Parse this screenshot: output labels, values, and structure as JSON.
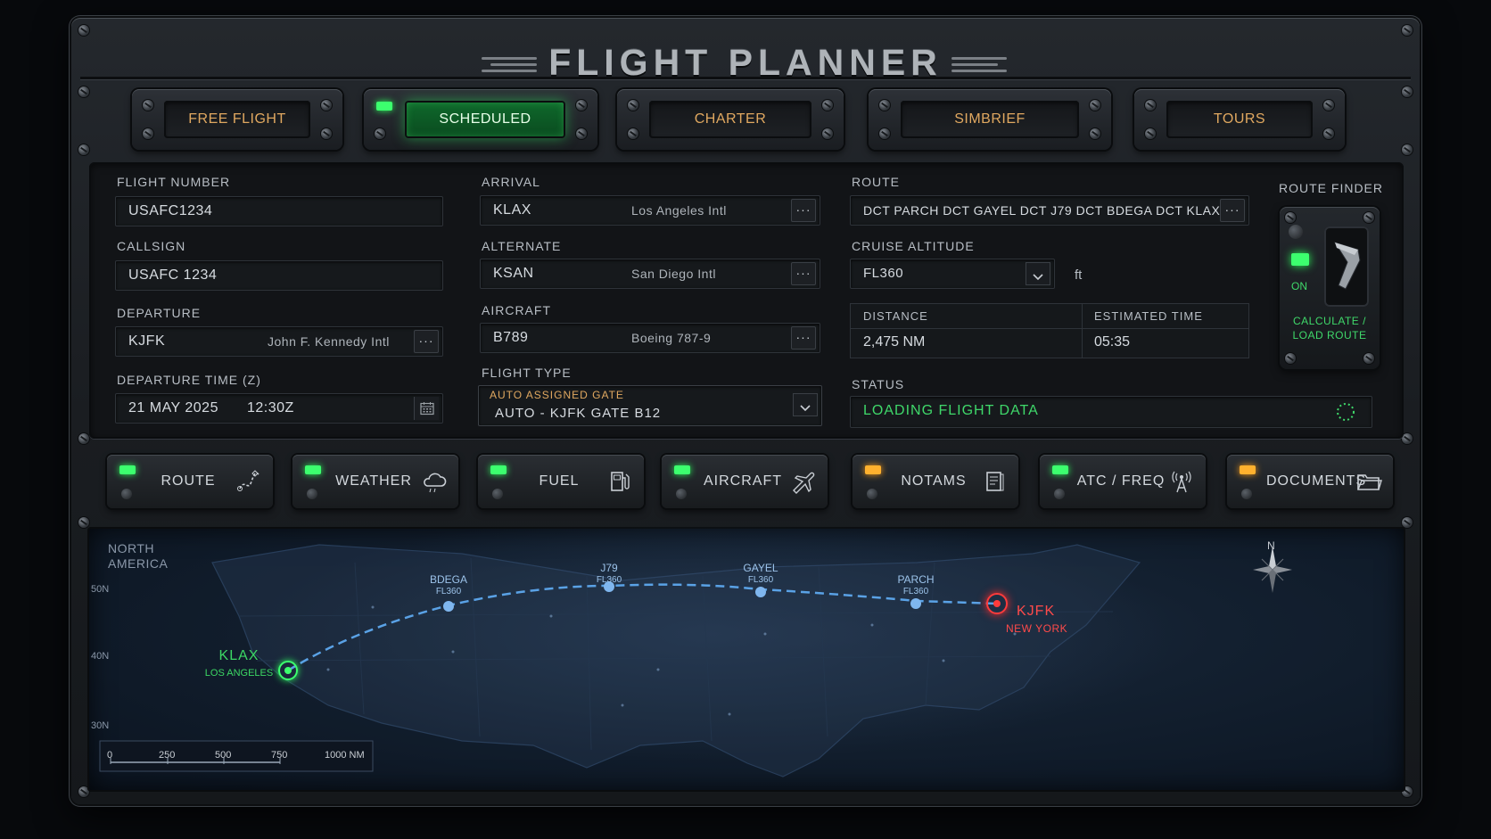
{
  "app": {
    "title": "FLIGHT PLANNER"
  },
  "modes": [
    {
      "label": "FREE FLIGHT",
      "active": false
    },
    {
      "label": "SCHEDULED",
      "active": true
    },
    {
      "label": "CHARTER",
      "active": false
    },
    {
      "label": "SIMBRIEF",
      "active": false
    },
    {
      "label": "TOURS",
      "active": false
    }
  ],
  "form": {
    "flight_number": {
      "label": "FLIGHT NUMBER",
      "value": "USAFC1234"
    },
    "callsign": {
      "label": "CALLSIGN",
      "value": "USAFC 1234"
    },
    "departure": {
      "label": "DEPARTURE",
      "code": "KJFK",
      "name": "John F. Kennedy Intl",
      "button": "···"
    },
    "departure_time": {
      "label": "DEPARTURE TIME (Z)",
      "date": "21 MAY 2025",
      "time": "12:30Z"
    },
    "arrival": {
      "label": "ARRIVAL",
      "code": "KLAX",
      "name": "Los Angeles Intl",
      "button": "···"
    },
    "alternate": {
      "label": "ALTERNATE",
      "code": "KSAN",
      "name": "San Diego Intl",
      "button": "···"
    },
    "aircraft": {
      "label": "AIRCRAFT",
      "code": "B789",
      "name": "Boeing 787-9",
      "button": "···"
    },
    "flight_type": {
      "label": "FLIGHT TYPE",
      "sublabel": "AUTO ASSIGNED GATE",
      "value": "AUTO - KJFK GATE B12"
    },
    "route": {
      "label": "ROUTE",
      "value": "DCT PARCH DCT GAYEL DCT J79 DCT BDEGA DCT KLAX",
      "button": "···"
    },
    "cruise_altitude": {
      "label": "CRUISE ALTITUDE",
      "value": "FL360",
      "unit": "ft"
    },
    "distance": {
      "label": "DISTANCE",
      "value": "2,475 NM"
    },
    "estimated_time": {
      "label": "ESTIMATED TIME",
      "value": "05:35"
    },
    "status": {
      "label": "STATUS",
      "value": "LOADING FLIGHT DATA"
    }
  },
  "route_finder": {
    "label": "ROUTE FINDER",
    "switch_state": "ON",
    "action": "CALCULATE / LOAD ROUTE"
  },
  "tools": [
    {
      "label": "ROUTE",
      "icon": "route-icon",
      "led": "green"
    },
    {
      "label": "WEATHER",
      "icon": "weather-icon",
      "led": "green"
    },
    {
      "label": "FUEL",
      "icon": "fuel-icon",
      "led": "green"
    },
    {
      "label": "AIRCRAFT",
      "icon": "aircraft-icon",
      "led": "green"
    },
    {
      "label": "NOTAMS",
      "icon": "notams-icon",
      "led": "amber"
    },
    {
      "label": "ATC / FREQ",
      "icon": "radio-tower-icon",
      "led": "green"
    },
    {
      "label": "DOCUMENTS",
      "icon": "folder-icon",
      "led": "amber"
    }
  ],
  "map": {
    "region": "NORTH AMERICA",
    "lat_labels": [
      "50N",
      "40N",
      "30N"
    ],
    "compass": "N",
    "scale": {
      "ticks": [
        "0",
        "250",
        "500",
        "750"
      ],
      "end": "1000 NM"
    },
    "origin": {
      "code": "KJFK",
      "city": "NEW YORK"
    },
    "destination": {
      "code": "KLAX",
      "city": "LOS ANGELES"
    },
    "waypoints": [
      {
        "name": "PARCH",
        "level": "FL360"
      },
      {
        "name": "GAYEL",
        "level": "FL360"
      },
      {
        "name": "J79",
        "level": "FL360"
      },
      {
        "name": "BDEGA",
        "level": "FL360"
      }
    ]
  },
  "colors": {
    "accent_green": "#3cff6e",
    "accent_amber": "#ffb12e",
    "origin_red": "#ff3b3b",
    "route_blue": "#5aa2e6",
    "label_orange": "#e0a860"
  }
}
